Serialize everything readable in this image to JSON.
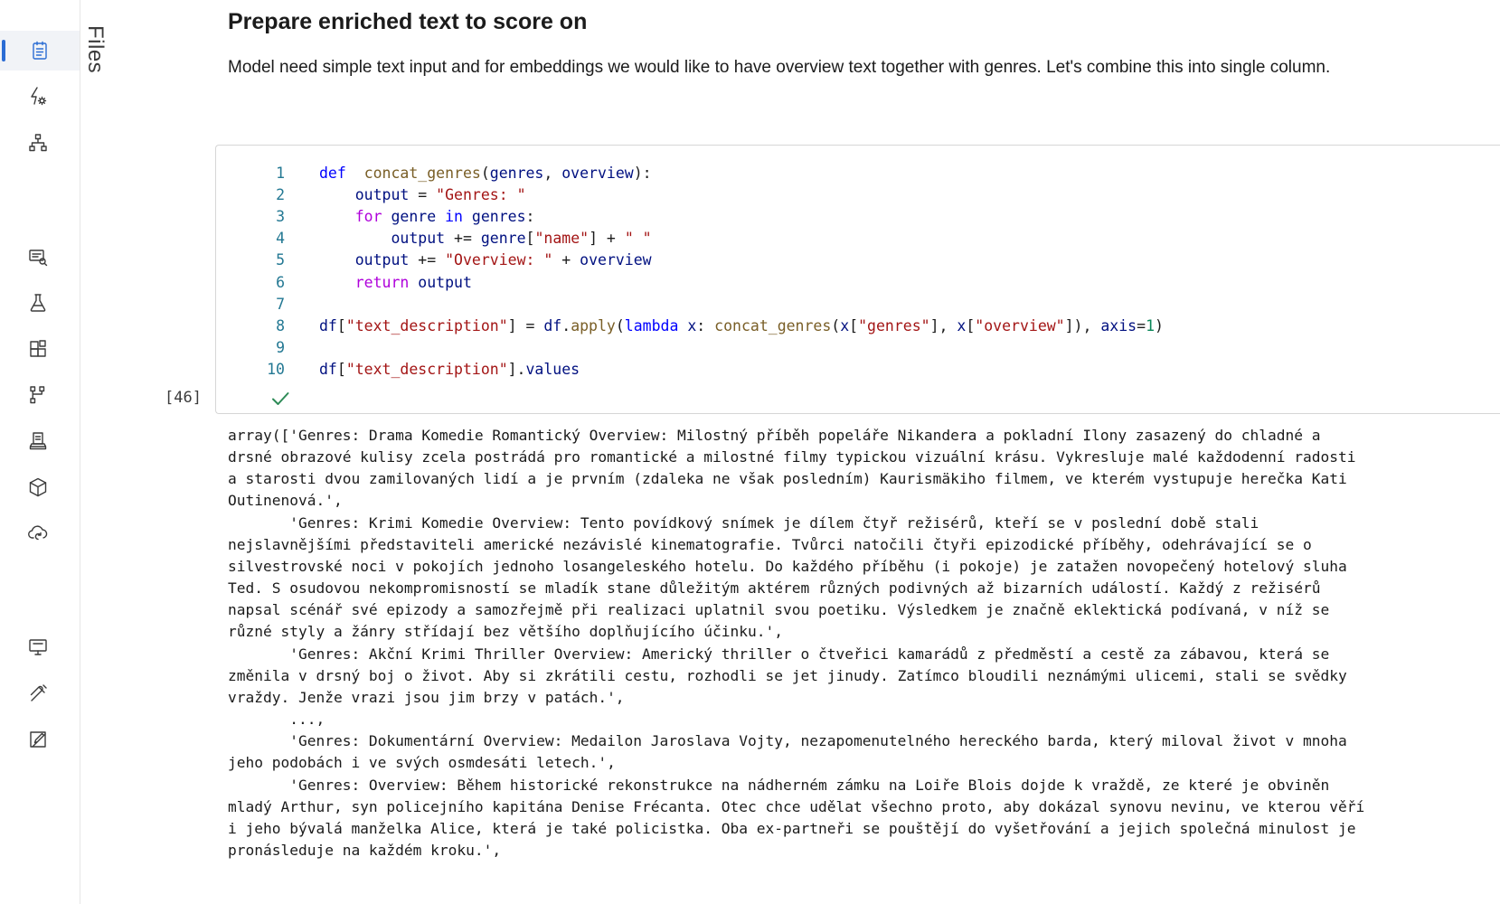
{
  "activity_bar": {
    "items": [
      {
        "name": "notebooks-icon",
        "active": true
      },
      {
        "name": "automated-ml-icon",
        "active": false
      },
      {
        "name": "designer-icon",
        "active": false
      },
      {
        "name": "data-icon",
        "active": false
      },
      {
        "name": "experiments-icon",
        "active": false
      },
      {
        "name": "pipelines-icon",
        "active": false
      },
      {
        "name": "models-icon",
        "active": false
      },
      {
        "name": "endpoints-icon",
        "active": false
      },
      {
        "name": "environments-icon",
        "active": false
      },
      {
        "name": "cloud-sync-icon",
        "active": false
      },
      {
        "name": "compute-icon",
        "active": false
      },
      {
        "name": "datastores-icon",
        "active": false
      },
      {
        "name": "data-labeling-icon",
        "active": false
      }
    ],
    "accent_color": "#2b6cd4"
  },
  "files_tab": {
    "label": "Files"
  },
  "markdown": {
    "heading": "Prepare enriched text to score on",
    "paragraph": "Model need simple text input and for embeddings we would like to have overview text together with genres. Let's combine this into single column."
  },
  "code_cell": {
    "execution_count": "[46]",
    "status": "success",
    "lines": [
      {
        "n": "1",
        "tokens": [
          [
            "kw",
            "def"
          ],
          [
            "",
            "  "
          ],
          [
            "fn",
            "concat_genres"
          ],
          [
            "",
            "("
          ],
          [
            "var",
            "genres"
          ],
          [
            "",
            ", "
          ],
          [
            "var",
            "overview"
          ],
          [
            "",
            "):"
          ]
        ]
      },
      {
        "n": "2",
        "tokens": [
          [
            "",
            "    "
          ],
          [
            "var",
            "output"
          ],
          [
            "",
            " = "
          ],
          [
            "str",
            "\"Genres: \""
          ]
        ]
      },
      {
        "n": "3",
        "tokens": [
          [
            "",
            "    "
          ],
          [
            "ctl",
            "for"
          ],
          [
            "",
            " "
          ],
          [
            "var",
            "genre"
          ],
          [
            "",
            " "
          ],
          [
            "kw",
            "in"
          ],
          [
            "",
            " "
          ],
          [
            "var",
            "genres"
          ],
          [
            "",
            ":"
          ]
        ]
      },
      {
        "n": "4",
        "tokens": [
          [
            "",
            "        "
          ],
          [
            "var",
            "output"
          ],
          [
            "",
            " += "
          ],
          [
            "var",
            "genre"
          ],
          [
            "",
            "["
          ],
          [
            "str",
            "\"name\""
          ],
          [
            "",
            "] + "
          ],
          [
            "str",
            "\" \""
          ]
        ]
      },
      {
        "n": "5",
        "tokens": [
          [
            "",
            "    "
          ],
          [
            "var",
            "output"
          ],
          [
            "",
            " += "
          ],
          [
            "str",
            "\"Overview: \""
          ],
          [
            "",
            " + "
          ],
          [
            "var",
            "overview"
          ]
        ]
      },
      {
        "n": "6",
        "tokens": [
          [
            "",
            "    "
          ],
          [
            "ctl",
            "return"
          ],
          [
            "",
            " "
          ],
          [
            "var",
            "output"
          ]
        ]
      },
      {
        "n": "7",
        "tokens": []
      },
      {
        "n": "8",
        "tokens": [
          [
            "var",
            "df"
          ],
          [
            "",
            "["
          ],
          [
            "str",
            "\"text_description\""
          ],
          [
            "",
            "] = "
          ],
          [
            "var",
            "df"
          ],
          [
            "",
            "."
          ],
          [
            "fn",
            "apply"
          ],
          [
            "",
            "("
          ],
          [
            "kw",
            "lambda"
          ],
          [
            "",
            " "
          ],
          [
            "var",
            "x"
          ],
          [
            "",
            ": "
          ],
          [
            "fn",
            "concat_genres"
          ],
          [
            "",
            "("
          ],
          [
            "var",
            "x"
          ],
          [
            "",
            "["
          ],
          [
            "str",
            "\"genres\""
          ],
          [
            "",
            "], "
          ],
          [
            "var",
            "x"
          ],
          [
            "",
            "["
          ],
          [
            "str",
            "\"overview\""
          ],
          [
            "",
            "]), "
          ],
          [
            "var",
            "axis"
          ],
          [
            "",
            "="
          ],
          [
            "num",
            "1"
          ],
          [
            "",
            ")"
          ]
        ]
      },
      {
        "n": "9",
        "tokens": []
      },
      {
        "n": "10",
        "tokens": [
          [
            "var",
            "df"
          ],
          [
            "",
            "["
          ],
          [
            "str",
            "\"text_description\""
          ],
          [
            "",
            "]."
          ],
          [
            "var",
            "values"
          ]
        ]
      }
    ]
  },
  "output_lines": [
    "array(['Genres: Drama Komedie Romantický Overview: Milostný příběh popeláře Nikandera a pokladní Ilony zasazený do chladné a",
    "drsné obrazové kulisy zcela postrádá pro romantické a milostné filmy typickou vizuální krásu. Vykresluje malé každodenní radosti",
    "a starosti dvou zamilovaných lidí a je prvním (zdaleka ne však posledním) Kaurismäkiho filmem, ve kterém vystupuje herečka Kati",
    "Outinenová.',",
    "       'Genres: Krimi Komedie Overview: Tento povídkový snímek je dílem čtyř režisérů, kteří se v poslední době stali",
    "nejslavnějšími představiteli americké nezávislé kinematografie. Tvůrci natočili čtyři epizodické příběhy, odehrávající se o",
    "silvestrovské noci v pokojích jednoho losangeleského hotelu. Do každého příběhu (i pokoje) je zatažen novopečený hotelový sluha",
    "Ted. S osudovou nekompromisností se mladík stane důležitým aktérem různých podivných až bizarních událostí. Každý z režisérů",
    "napsal scénář své epizody a samozřejmě při realizaci uplatnil svou poetiku. Výsledkem je značně eklektická podívaná, v níž se",
    "různé styly a žánry střídají bez většího doplňujícího účinku.',",
    "       'Genres: Akční Krimi Thriller Overview: Americký thriller o čtveřici kamarádů z předměstí a cestě za zábavou, která se",
    "změnila v drsný boj o život. Aby si zkrátili cestu, rozhodli se jet jinudy. Zatímco bloudili neznámými ulicemi, stali se svědky",
    "vraždy. Jenže vrazi jsou jim brzy v patách.',",
    "       ...,",
    "       'Genres: Dokumentární Overview: Medailon Jaroslava Vojty, nezapomenutelného hereckého barda, který miloval život v mnoha",
    "jeho podobách i ve svých osmdesáti letech.',",
    "       'Genres: Overview: Během historické rekonstrukce na nádherném zámku na Loiře Blois dojde k vraždě, ze které je obviněn",
    "mladý Arthur, syn policejního kapitána Denise Frécanta. Otec chce udělat všechno proto, aby dokázal synovu nevinu, ve kterou věří",
    "i jeho bývalá manželka Alice, která je také policistka. Oba ex-partneři se pouštějí do vyšetřování a jejich společná minulost je",
    "pronásleduje na každém kroku.',"
  ]
}
